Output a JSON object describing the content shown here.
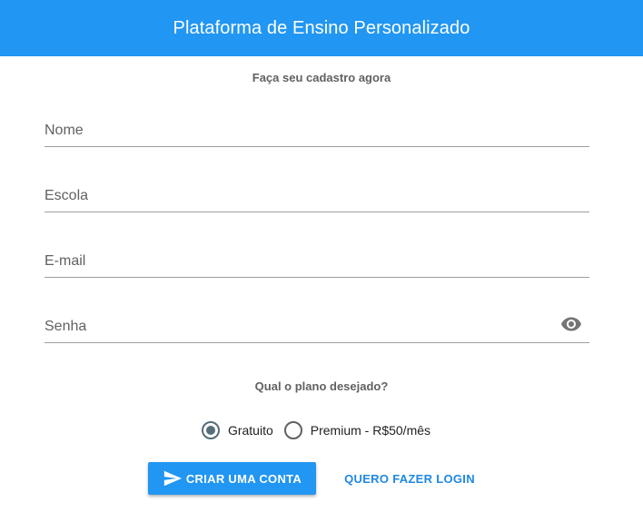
{
  "header": {
    "title": "Plataforma de Ensino Personalizado"
  },
  "form": {
    "subtitle": "Faça seu cadastro agora",
    "fields": {
      "name": {
        "placeholder": "Nome",
        "value": ""
      },
      "school": {
        "placeholder": "Escola",
        "value": ""
      },
      "email": {
        "placeholder": "E-mail",
        "value": ""
      },
      "password": {
        "placeholder": "Senha",
        "value": "",
        "toggle_icon": "eye-icon"
      }
    },
    "plan": {
      "question": "Qual o plano desejado?",
      "options": [
        {
          "label": "Gratuito",
          "selected": true
        },
        {
          "label": "Premium - R$50/mês",
          "selected": false
        }
      ]
    },
    "actions": {
      "create_label": "CRIAR UMA CONTA",
      "create_icon": "send-icon",
      "login_label": "QUERO FAZER LOGIN"
    }
  },
  "colors": {
    "primary": "#2196f3",
    "radio_selected": "#546e7a",
    "link": "#1e88e5"
  }
}
